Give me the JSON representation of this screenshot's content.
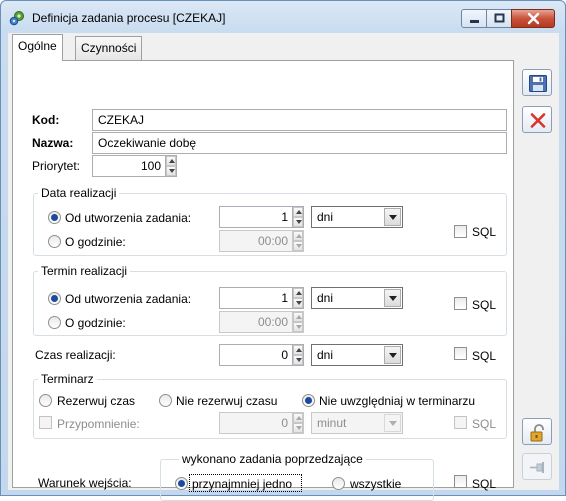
{
  "window": {
    "title": "Definicja zadania procesu [CZEKAJ]",
    "icons": [
      "app-gear-icon",
      "minimize-icon",
      "maximize-icon",
      "close-icon"
    ]
  },
  "tabs": [
    {
      "label": "Ogólne",
      "active": true
    },
    {
      "label": "Czynności",
      "active": false
    }
  ],
  "form": {
    "kod_label": "Kod:",
    "kod_value": "CZEKAJ",
    "nazwa_label": "Nazwa:",
    "nazwa_value": "Oczekiwanie dobę",
    "priorytet_label": "Priorytet:",
    "priorytet_value": "100"
  },
  "data_realizacji": {
    "legend": "Data realizacji",
    "opt_od_utworzenia": "Od utworzenia zadania:",
    "value": "1",
    "unit": "dni",
    "opt_godzinie": "O godzinie:",
    "time": "00:00",
    "sql": "SQL",
    "selected": "od_utworzenia"
  },
  "termin_realizacji": {
    "legend": "Termin realizacji",
    "opt_od_utworzenia": "Od utworzenia zadania:",
    "value": "1",
    "unit": "dni",
    "opt_godzinie": "O godzinie:",
    "time": "00:00",
    "sql": "SQL",
    "selected": "od_utworzenia"
  },
  "czas_realizacji": {
    "label": "Czas realizacji:",
    "value": "0",
    "unit": "dni",
    "sql": "SQL"
  },
  "terminarz": {
    "legend": "Terminarz",
    "opt_rezerwuj": "Rezerwuj czas",
    "opt_nie_rezerwuj": "Nie rezerwuj czasu",
    "opt_nie_uwzgledniaj": "Nie uwzględniaj w terminarzu",
    "selected": "nie_uwzgledniaj",
    "przypomnienie_label": "Przypomnienie:",
    "przypomnienie_value": "0",
    "przypomnienie_unit": "minut",
    "sql": "SQL"
  },
  "warunek": {
    "label": "Warunek wejścia:",
    "legend": "wykonano zadania poprzedzające",
    "opt_przynajmniej": "przynajmniej jedno",
    "opt_wszystkie": "wszystkie",
    "selected": "przynajmniej",
    "sql": "SQL"
  },
  "side_buttons": {
    "save": "save-icon",
    "cancel": "cancel-icon",
    "lock": "lock-icon",
    "pin": "pin-icon"
  },
  "colors": {
    "titlebar": "#c9dcf0",
    "close_button": "#c9523a",
    "radio_dot": "#1c4a9e",
    "cancel_x": "#d9342b"
  }
}
